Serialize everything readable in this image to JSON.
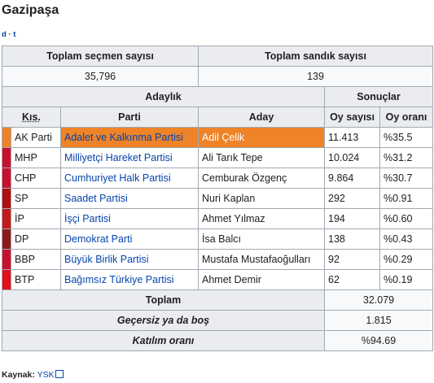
{
  "title": "Gazipaşa",
  "navbar": {
    "view": "d",
    "sep": "·",
    "talk": "t"
  },
  "summary": {
    "voters_label": "Toplam seçmen sayısı",
    "ballots_label": "Toplam sandık sayısı",
    "voters_value": "35,796",
    "ballots_value": "139"
  },
  "headers": {
    "candidacy": "Adaylık",
    "results": "Sonuçlar",
    "abbr": "Kıs.",
    "party": "Parti",
    "candidate": "Aday",
    "votes": "Oy sayısı",
    "share": "Oy oranı"
  },
  "rows": [
    {
      "color": "#ee8328",
      "abbr": "AK Parti",
      "party": "Adalet ve Kalkınma Partisi",
      "candidate": "Adil Çelik",
      "votes": "11.413",
      "share": "%35.5",
      "highlight": true
    },
    {
      "color": "#c8102e",
      "abbr": "MHP",
      "party": "Milliyetçi Hareket Partisi",
      "candidate": "Ali Tarık Tepe",
      "votes": "10.024",
      "share": "%31.2"
    },
    {
      "color": "#c8102e",
      "abbr": "CHP",
      "party": "Cumhuriyet Halk Partisi",
      "candidate": "Cemburak Özgenç",
      "votes": "9.864",
      "share": "%30.7"
    },
    {
      "color": "#b01010",
      "abbr": "SP",
      "party": "Saadet Partisi",
      "candidate": "Nuri Kaplan",
      "votes": "292",
      "share": "%0.91"
    },
    {
      "color": "#c21a1a",
      "abbr": "İP",
      "party": "İşçi Partisi",
      "candidate": "Ahmet Yılmaz",
      "votes": "194",
      "share": "%0.60"
    },
    {
      "color": "#8b1a1a",
      "abbr": "DP",
      "party": "Demokrat Parti",
      "candidate": "İsa Balcı",
      "votes": "138",
      "share": "%0.43"
    },
    {
      "color": "#c8102e",
      "abbr": "BBP",
      "party": "Büyük Birlik Partisi",
      "candidate": "Mustafa Mustafaoğulları",
      "votes": "92",
      "share": "%0.29"
    },
    {
      "color": "#e0101e",
      "abbr": "BTP",
      "party": "Bağımsız Türkiye Partisi",
      "candidate": "Ahmet Demir",
      "votes": "62",
      "share": "%0.19"
    }
  ],
  "totals": {
    "total_label": "Toplam",
    "total_value": "32.079",
    "invalid_label": "Geçersiz ya da boş",
    "invalid_value": "1.815",
    "turnout_label": "Katılım oranı",
    "turnout_value": "%94.69"
  },
  "source": {
    "label": "Kaynak:",
    "link": "YSK"
  }
}
